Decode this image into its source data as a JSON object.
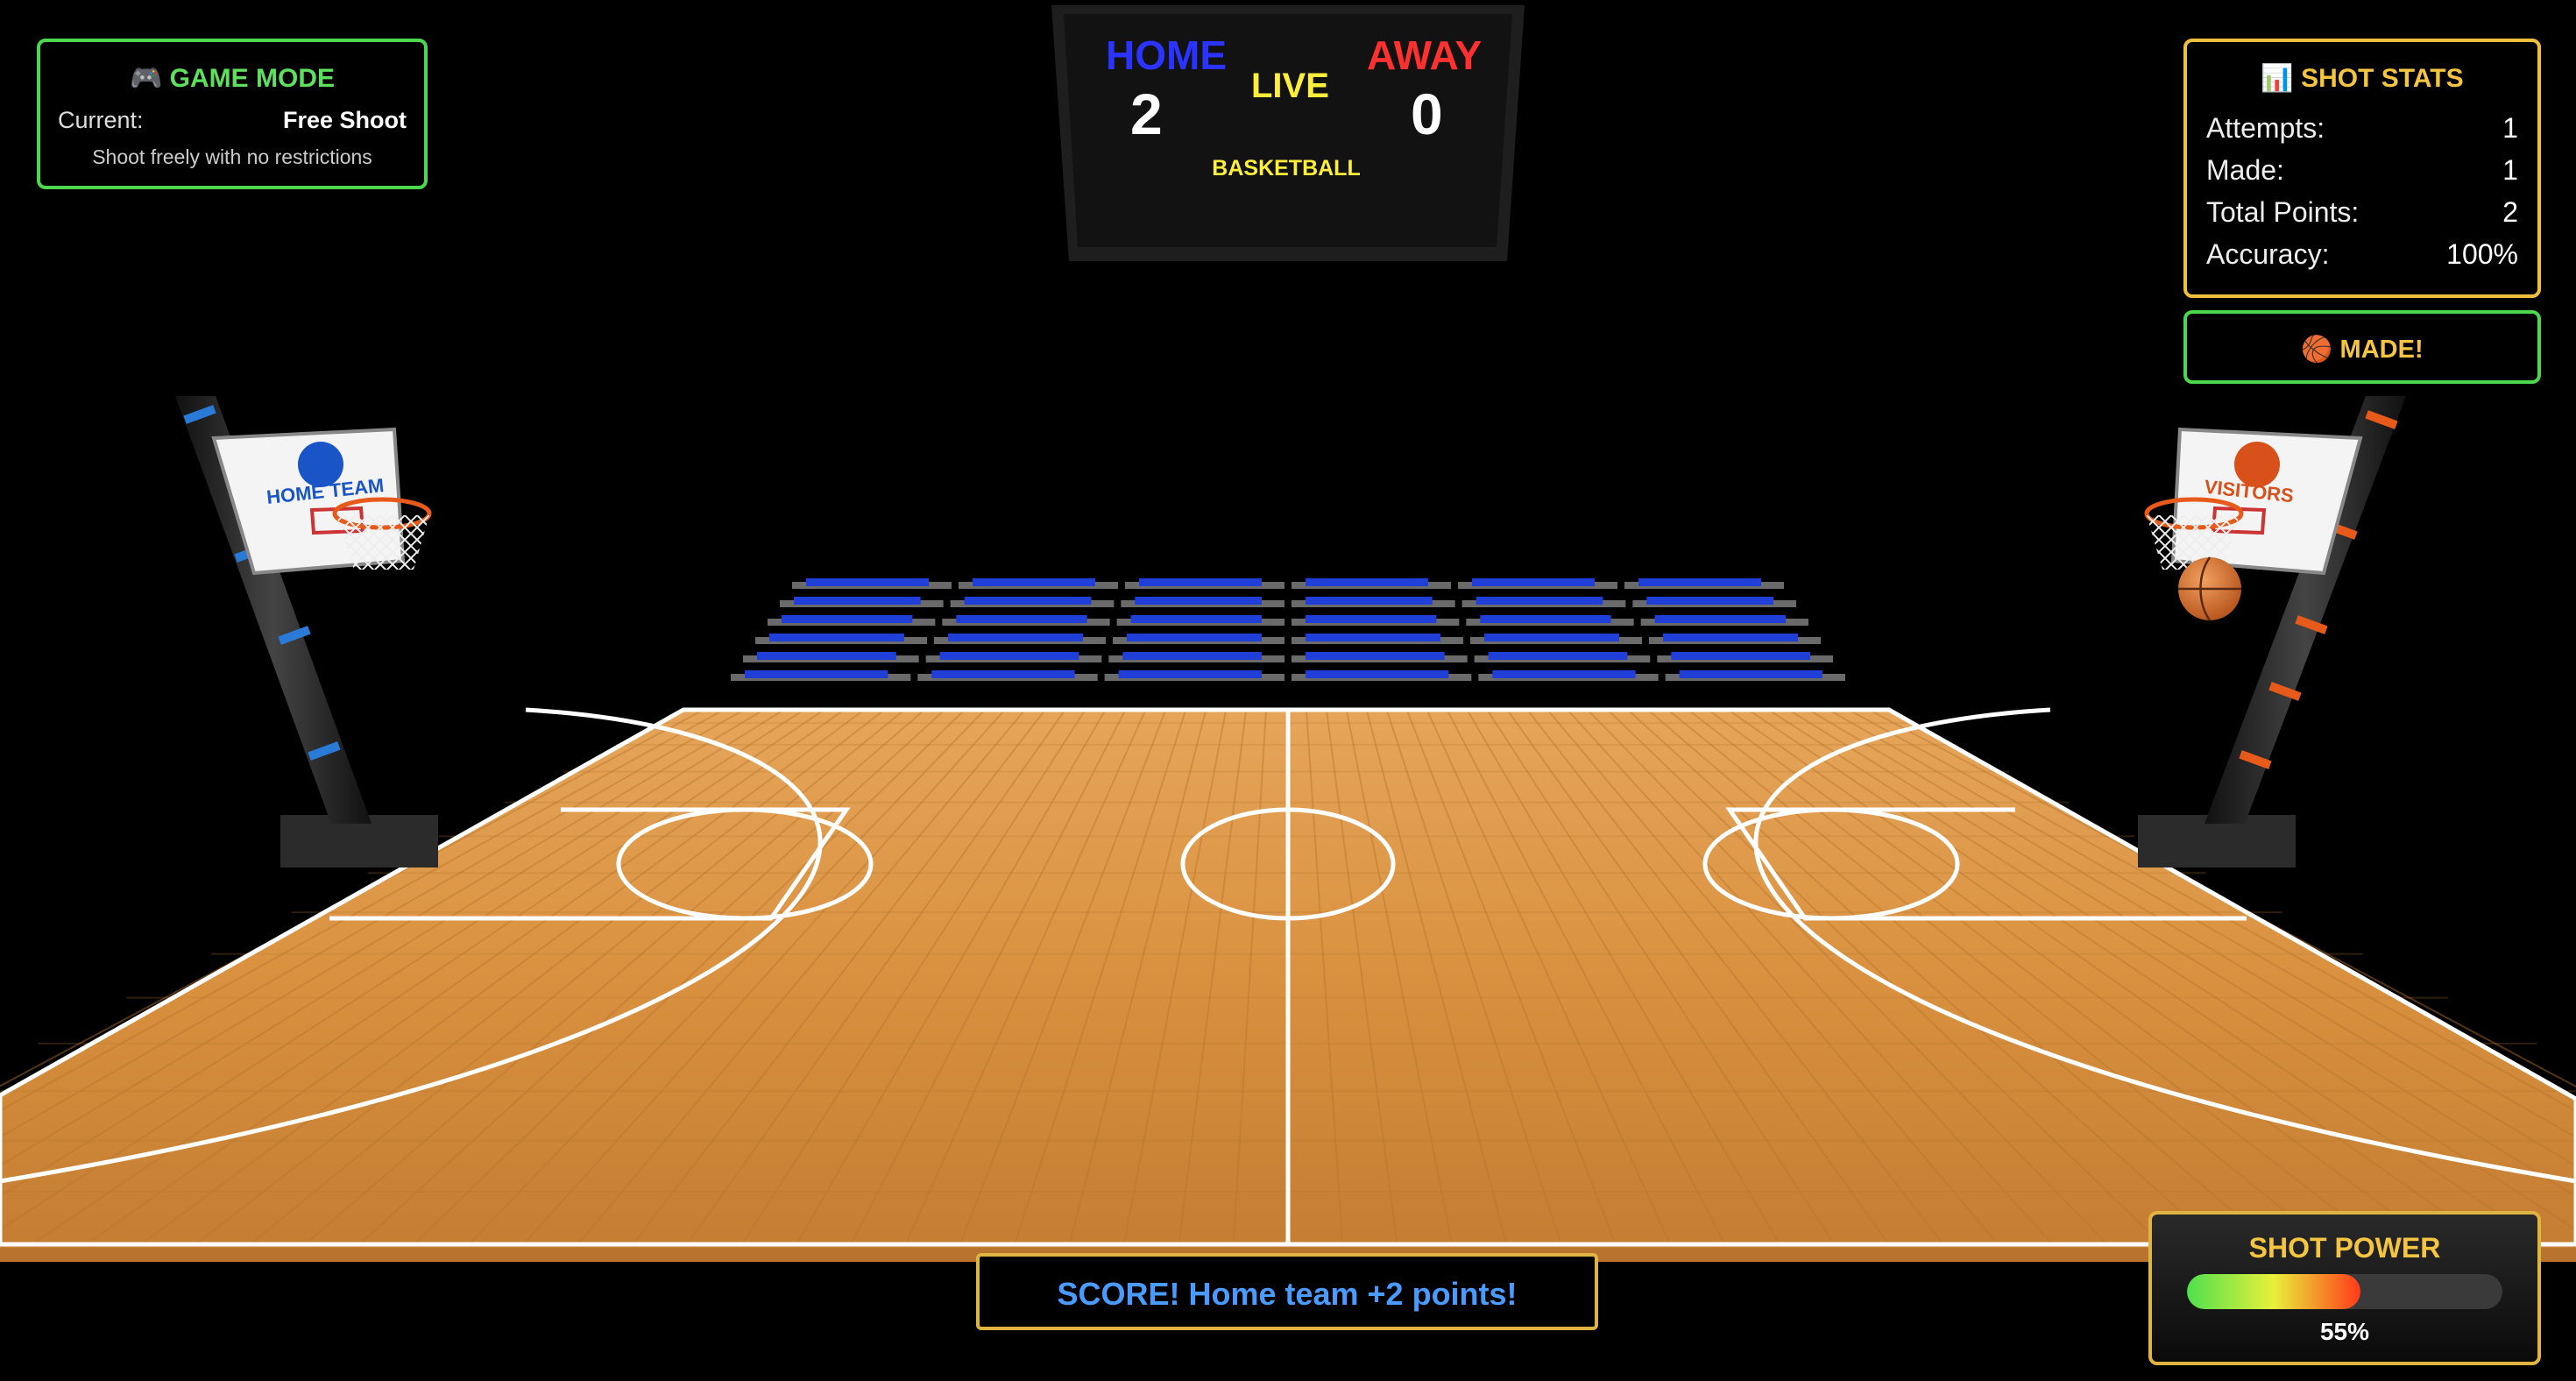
{
  "scoreboard": {
    "home_label": "HOME",
    "away_label": "AWAY",
    "status": "LIVE",
    "home_score": "2",
    "away_score": "0",
    "sport": "BASKETBALL"
  },
  "game_mode": {
    "title": "🎮 GAME MODE",
    "current_label": "Current:",
    "current_value": "Free Shoot",
    "description": "Shoot freely with no restrictions"
  },
  "shot_stats": {
    "title": "📊 SHOT STATS",
    "attempts_label": "Attempts:",
    "attempts": "1",
    "made_label": "Made:",
    "made": "1",
    "points_label": "Total Points:",
    "points": "2",
    "accuracy_label": "Accuracy:",
    "accuracy": "100%"
  },
  "result_banner": "🏀 MADE!",
  "score_message": "SCORE! Home team +2 points!",
  "shot_power": {
    "title": "SHOT POWER",
    "label": "55%",
    "level": 0.55
  },
  "hoops": {
    "left_backboard_text": "HOME TEAM",
    "right_backboard_text": "VISITORS"
  },
  "colors": {
    "home": "#2a33ff",
    "away": "#ff3030",
    "live": "#ffef3a",
    "panel_green": "#4cd84c",
    "panel_gold": "#e0b440",
    "seats": "#1f3fd8",
    "court": "#d9913f"
  }
}
